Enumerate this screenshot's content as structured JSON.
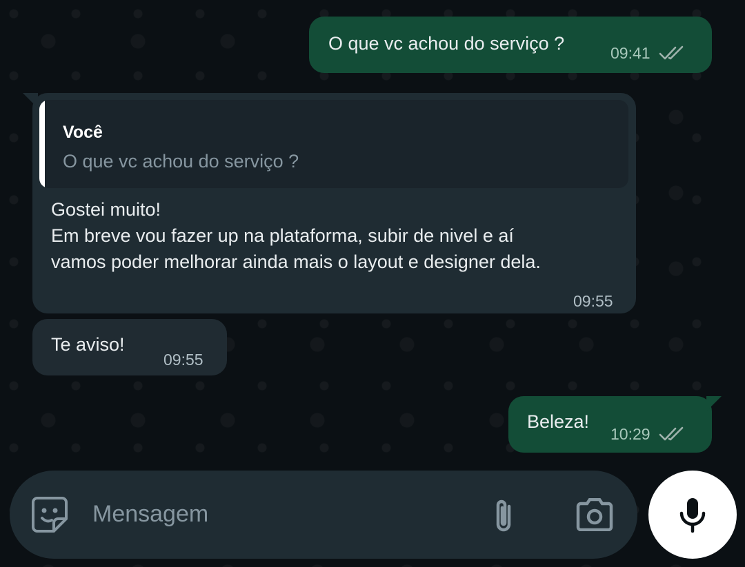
{
  "messages": {
    "m1": {
      "text": "O que vc achou do serviço ?",
      "time": "09:41"
    },
    "m2": {
      "quote_author": "Você",
      "quote_text": "O que vc achou do serviço ?",
      "text": "Gostei muito!\nEm breve vou fazer up na plataforma, subir de nivel e aí\nvamos poder melhorar ainda mais o layout e designer dela.",
      "time": "09:55"
    },
    "m3": {
      "text": "Te aviso!",
      "time": "09:55"
    },
    "m4": {
      "text": "Beleza!",
      "time": "10:29"
    }
  },
  "composer": {
    "placeholder": "Mensagem"
  },
  "icons": {
    "read_receipt": "double-check-icon",
    "sticker": "sticker-icon",
    "attach": "paperclip-icon",
    "camera": "camera-icon",
    "mic": "microphone-icon"
  },
  "colors": {
    "outgoing_bubble": "#134d37",
    "incoming_bubble": "#1f2c33",
    "background": "#0b1014"
  }
}
